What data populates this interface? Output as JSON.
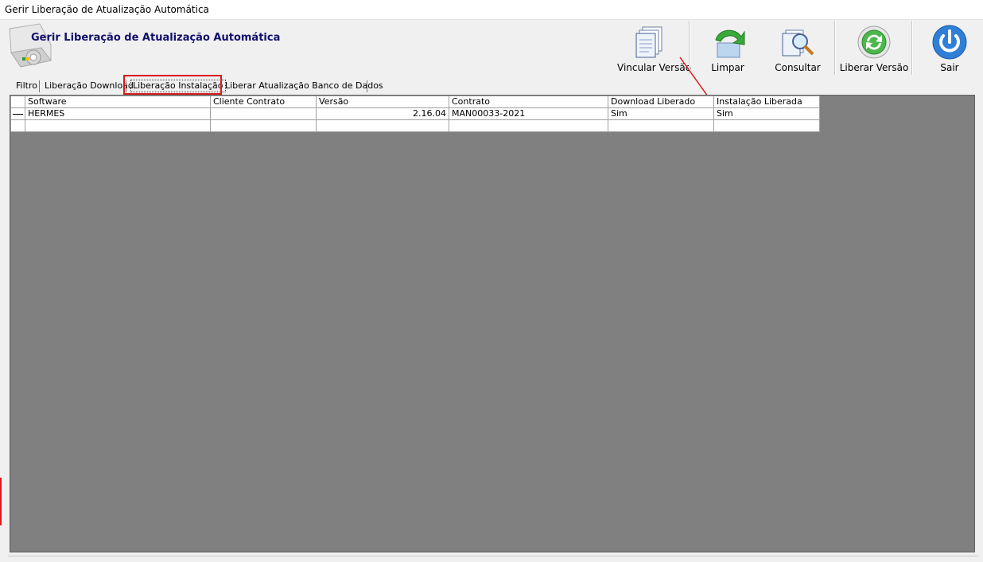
{
  "window": {
    "title": "Gerir Liberação de Atualização Automática"
  },
  "header": {
    "title": "Gerir Liberação de Atualização Automática"
  },
  "toolbar": {
    "vincular_label": "Vincular Versão",
    "limpar_label": "Limpar",
    "consultar_label": "Consultar",
    "liberar_label": "Liberar Versão",
    "sair_label": "Sair"
  },
  "tabs": [
    {
      "label": "Filtro"
    },
    {
      "label": "Liberação Download"
    },
    {
      "label": "Liberação Instalação"
    },
    {
      "label": "Liberar Atualização Banco de Dados"
    }
  ],
  "grid": {
    "columns": [
      "Software",
      "Cliente Contrato",
      "Versão",
      "Contrato",
      "Download Liberado",
      "Instalação Liberada"
    ],
    "rows": [
      {
        "software": "HERMES",
        "cliente": "",
        "versao": "2.16.04",
        "contrato": "MAN00033-2021",
        "download": "Sim",
        "instalacao": "Sim"
      }
    ]
  },
  "colors": {
    "accent_red": "#d91b1b",
    "title_blue": "#10106b",
    "grid_bg": "#808080"
  }
}
